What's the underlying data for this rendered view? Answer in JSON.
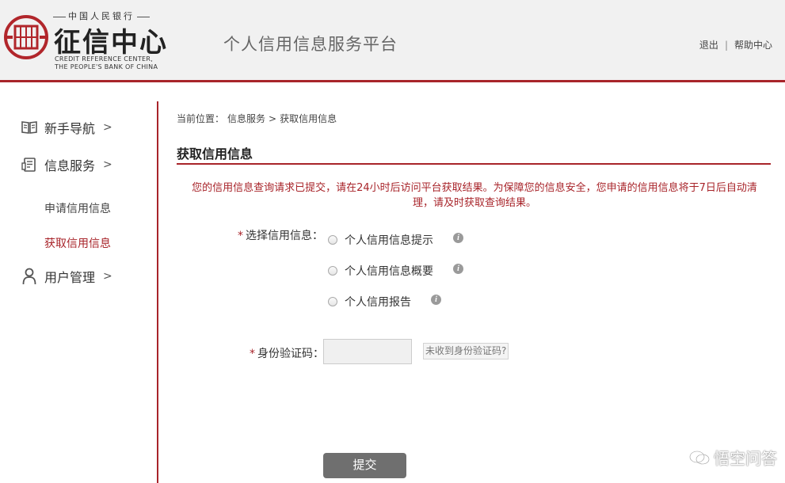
{
  "header": {
    "logo_top": "中国人民银行",
    "logo_main": "征信中心",
    "logo_en_line1": "CREDIT REFERENCE CENTER,",
    "logo_en_line2": "THE PEOPLE'S BANK OF CHINA",
    "platform_title": "个人信用信息服务平台",
    "logout_label": "退出",
    "separator": "|",
    "help_label": "帮助中心"
  },
  "sidebar": {
    "nav_guide": "新手导航",
    "nav_info_service": "信息服务",
    "sub_apply": "申请信用信息",
    "sub_get": "获取信用信息",
    "nav_user": "用户管理",
    "arrow": ">"
  },
  "breadcrumb": {
    "prefix": "当前位置：",
    "level1": "信息服务",
    "separator": ">",
    "level2": "获取信用信息"
  },
  "main": {
    "title": "获取信用信息",
    "notice": "您的信用信息查询请求已提交，请在24小时后访问平台获取结果。为保障您的信息安全，您申请的信用信息将于7日后自动清理，请及时获取查询结果。",
    "select_label": "选择信用信息：",
    "required_mark": "*",
    "options": [
      {
        "label": "个人信用信息提示"
      },
      {
        "label": "个人信用信息概要"
      },
      {
        "label": "个人信用报告"
      }
    ],
    "info_icon": "i",
    "code_label": "身份验证码：",
    "code_value": "",
    "resend_label": "未收到身份验证码?",
    "submit_label": "提交"
  },
  "watermark": {
    "text": "悟空问答"
  },
  "colors": {
    "accent": "#a8242a",
    "header_bg": "#f1f1f1",
    "button_bg": "#6f6f6f"
  }
}
